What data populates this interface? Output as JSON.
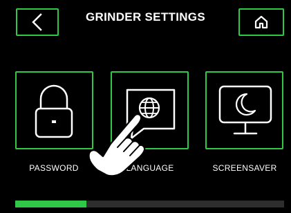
{
  "header": {
    "title": "GRINDER SETTINGS",
    "back_icon": "chevron-left-icon",
    "home_icon": "home-icon"
  },
  "tiles": [
    {
      "label": "PASSWORD",
      "icon": "lock-icon"
    },
    {
      "label": "LANGUAGE",
      "icon": "globe-display-icon"
    },
    {
      "label": "SCREENSAVER",
      "icon": "moon-monitor-icon"
    }
  ],
  "pager": {
    "progress_fraction": 0.265
  },
  "colors": {
    "accent": "#2fc947",
    "background": "#000000",
    "track": "#2e2e2e"
  }
}
